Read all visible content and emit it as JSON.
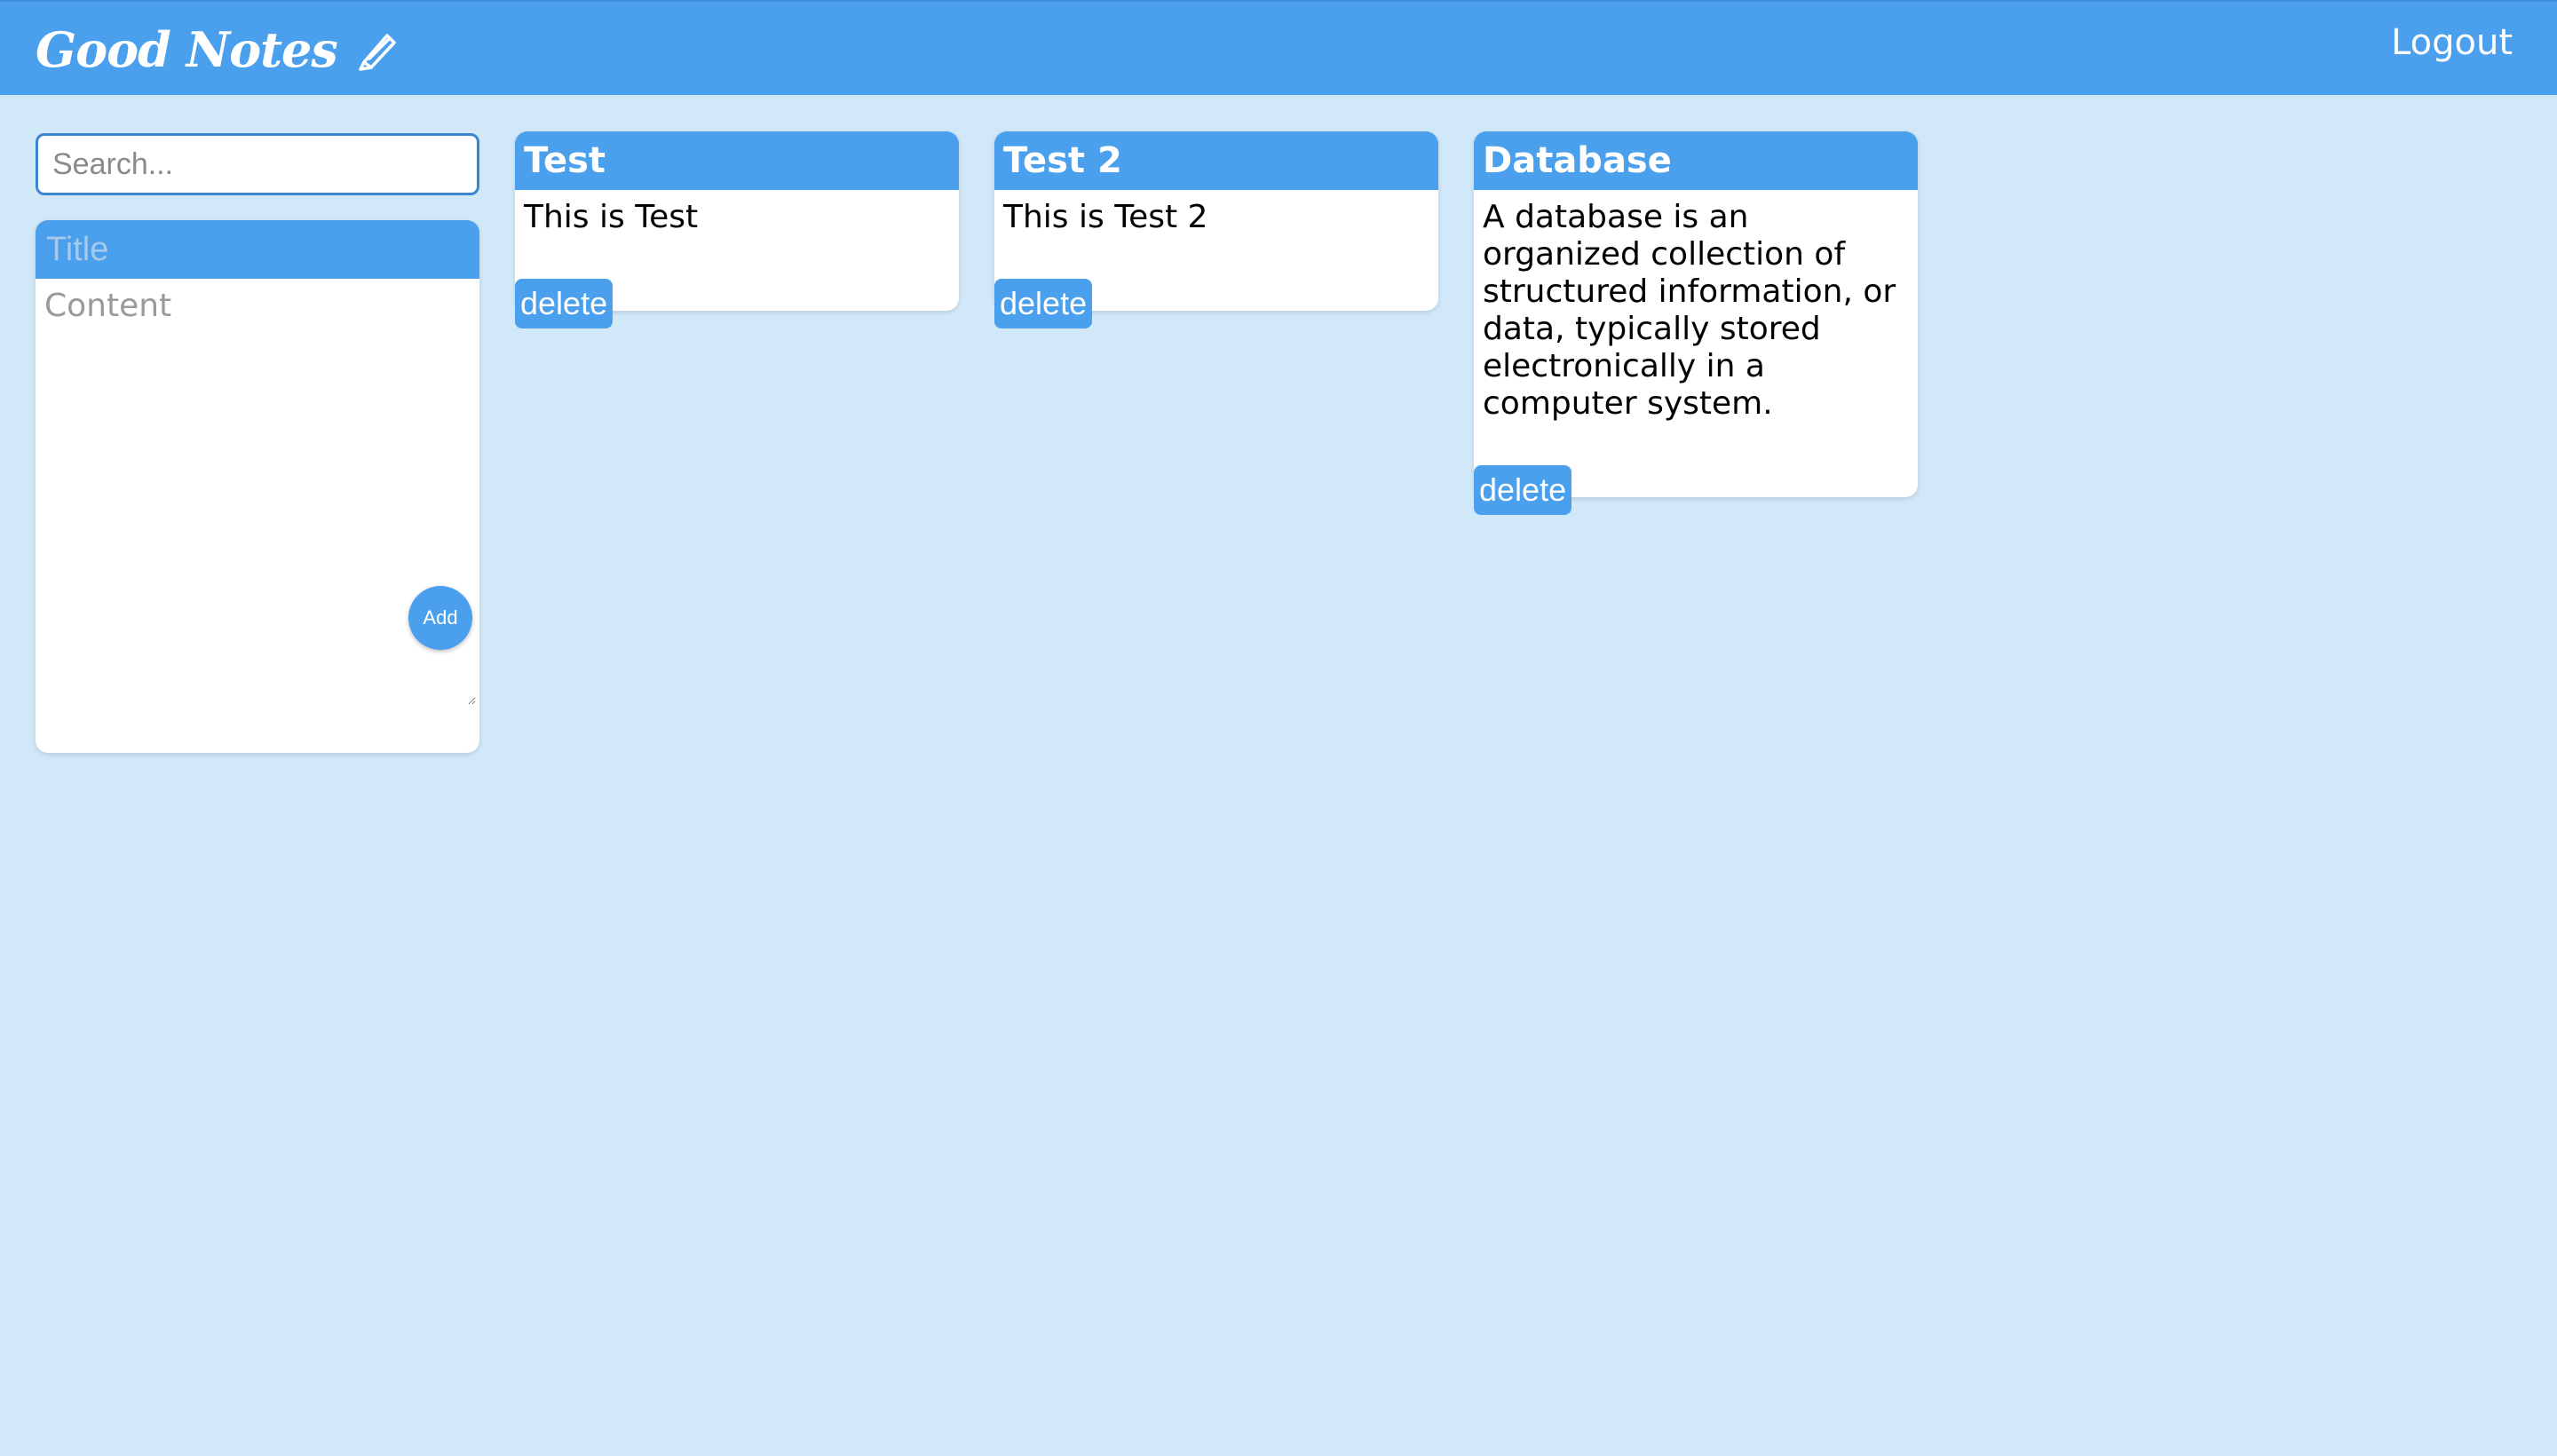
{
  "header": {
    "brand": "Good Notes",
    "logout_label": "Logout",
    "colors": {
      "header_bg": "#4aa0ec",
      "page_bg": "#d1e8f8"
    }
  },
  "search": {
    "placeholder": "Search..."
  },
  "composer": {
    "title_placeholder": "Title",
    "content_placeholder": "Content",
    "add_label": "Add"
  },
  "notes": [
    {
      "title": "Test",
      "content": "This is Test",
      "delete_label": "delete"
    },
    {
      "title": "Test 2",
      "content": "This is Test 2",
      "delete_label": "delete"
    },
    {
      "title": "Database",
      "content": "A database is an organized collection of structured information, or data, typically stored electronically in a computer system.",
      "delete_label": "delete"
    }
  ],
  "icons": {
    "brand_icon": "pencil-icon"
  }
}
